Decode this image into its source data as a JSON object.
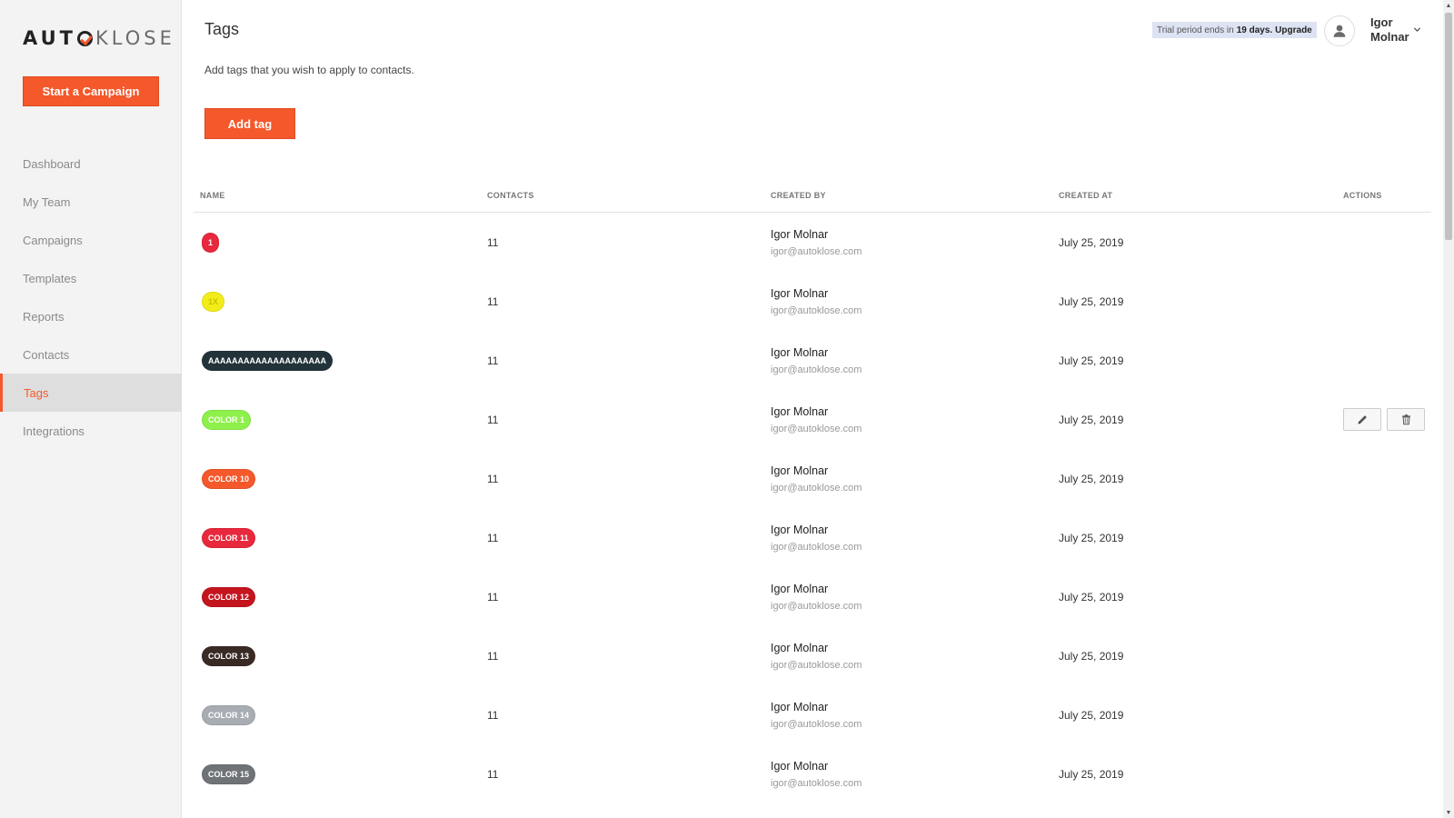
{
  "brand": {
    "logo_left": "AUT",
    "logo_right": "KLOSE",
    "accent": "#f4582b"
  },
  "sidebar": {
    "cta_label": "Start a Campaign",
    "items": [
      {
        "label": "Dashboard",
        "active": false
      },
      {
        "label": "My Team",
        "active": false
      },
      {
        "label": "Campaigns",
        "active": false
      },
      {
        "label": "Templates",
        "active": false
      },
      {
        "label": "Reports",
        "active": false
      },
      {
        "label": "Contacts",
        "active": false
      },
      {
        "label": "Tags",
        "active": true
      },
      {
        "label": "Integrations",
        "active": false
      }
    ]
  },
  "header": {
    "title": "Tags",
    "subtitle": "Add tags that you wish to apply to contacts.",
    "add_button": "Add tag",
    "trial_prefix": "Trial period ends in",
    "trial_days": "19 days.",
    "trial_upgrade": "Upgrade",
    "user_name": "Igor Molnar"
  },
  "table": {
    "columns": [
      "NAME",
      "CONTACTS",
      "CREATED BY",
      "CREATED AT",
      "ACTIONS"
    ],
    "rows": [
      {
        "tag": "1",
        "color": "#e8283c",
        "text_color": "#ffffff",
        "contacts": "11",
        "creator": "Igor Molnar",
        "email": "igor@autoklose.com",
        "date": "July 25, 2019",
        "show_actions": false
      },
      {
        "tag": "1X",
        "color": "#f3ec1a",
        "text_color": "#c9c200",
        "contacts": "11",
        "creator": "Igor Molnar",
        "email": "igor@autoklose.com",
        "date": "July 25, 2019",
        "show_actions": false
      },
      {
        "tag": "AAAAAAAAAAAAAAAAAAAA",
        "color": "#22343a",
        "text_color": "#ffffff",
        "contacts": "11",
        "creator": "Igor Molnar",
        "email": "igor@autoklose.com",
        "date": "July 25, 2019",
        "show_actions": false
      },
      {
        "tag": "COLOR 1",
        "color": "#8ef04a",
        "text_color": "#ffffff",
        "contacts": "11",
        "creator": "Igor Molnar",
        "email": "igor@autoklose.com",
        "date": "July 25, 2019",
        "show_actions": true
      },
      {
        "tag": "COLOR 10",
        "color": "#f4582b",
        "text_color": "#ffffff",
        "contacts": "11",
        "creator": "Igor Molnar",
        "email": "igor@autoklose.com",
        "date": "July 25, 2019",
        "show_actions": false
      },
      {
        "tag": "COLOR 11",
        "color": "#e8283c",
        "text_color": "#ffffff",
        "contacts": "11",
        "creator": "Igor Molnar",
        "email": "igor@autoklose.com",
        "date": "July 25, 2019",
        "show_actions": false
      },
      {
        "tag": "COLOR 12",
        "color": "#c4151f",
        "text_color": "#ffffff",
        "contacts": "11",
        "creator": "Igor Molnar",
        "email": "igor@autoklose.com",
        "date": "July 25, 2019",
        "show_actions": false
      },
      {
        "tag": "COLOR 13",
        "color": "#3a2a26",
        "text_color": "#ffffff",
        "contacts": "11",
        "creator": "Igor Molnar",
        "email": "igor@autoklose.com",
        "date": "July 25, 2019",
        "show_actions": false
      },
      {
        "tag": "COLOR 14",
        "color": "#a7adb3",
        "text_color": "#ffffff",
        "contacts": "11",
        "creator": "Igor Molnar",
        "email": "igor@autoklose.com",
        "date": "July 25, 2019",
        "show_actions": false
      },
      {
        "tag": "COLOR 15",
        "color": "#6f7377",
        "text_color": "#ffffff",
        "contacts": "11",
        "creator": "Igor Molnar",
        "email": "igor@autoklose.com",
        "date": "July 25, 2019",
        "show_actions": false
      }
    ],
    "actions": {
      "edit_icon": "pencil-icon",
      "delete_icon": "trash-icon"
    }
  }
}
